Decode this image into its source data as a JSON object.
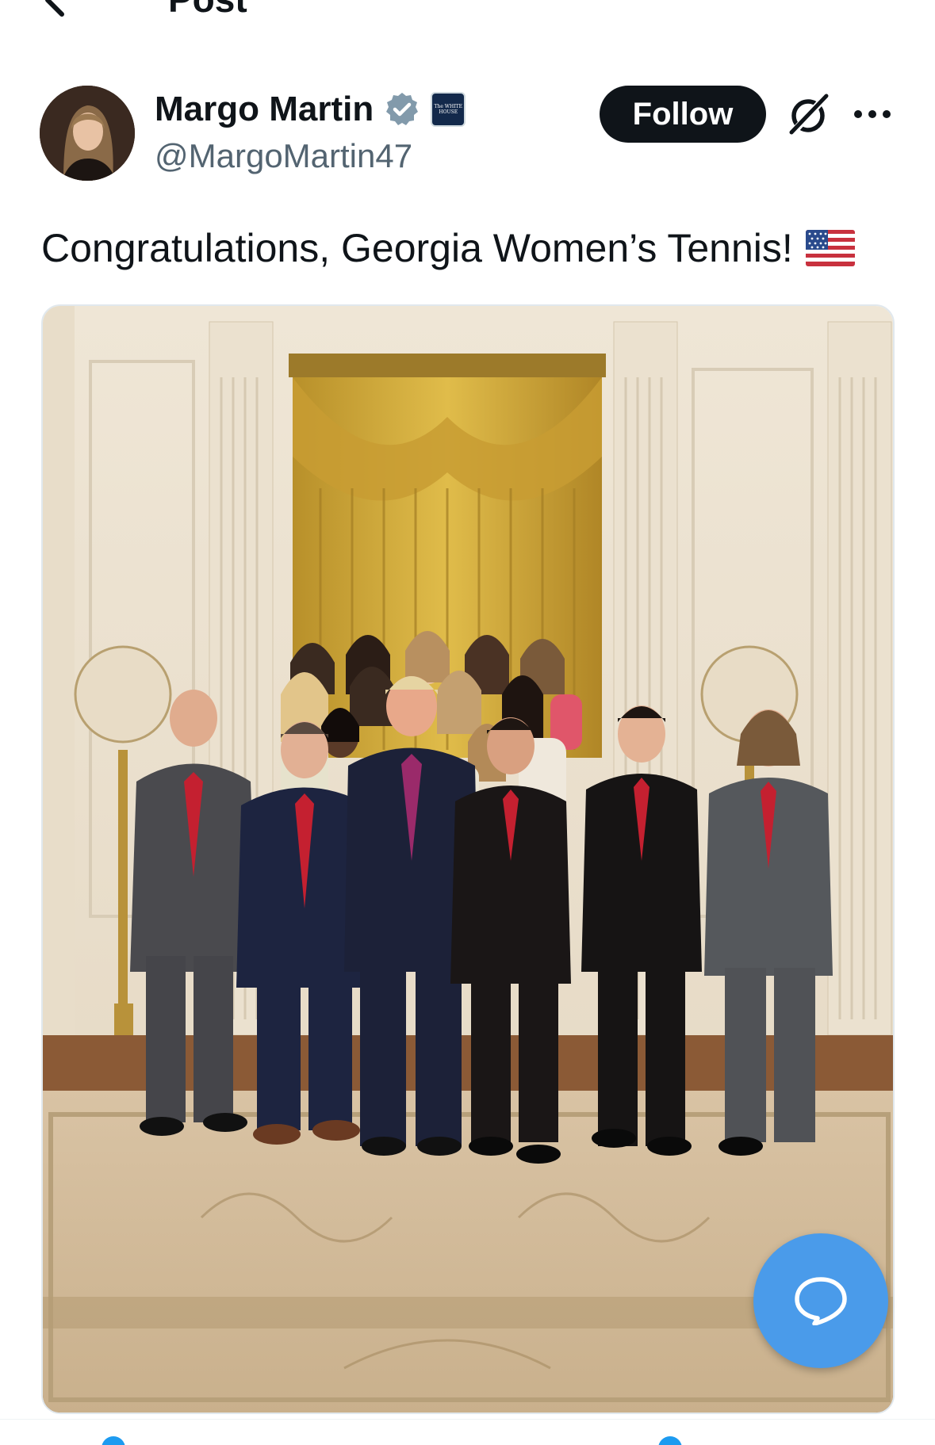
{
  "header": {
    "title": "Post"
  },
  "author": {
    "display_name": "Margo Martin",
    "handle": "@MargoMartin47",
    "affiliate_badge_text": "The WHITE HOUSE"
  },
  "actions": {
    "follow_label": "Follow"
  },
  "post": {
    "text": "Congratulations, Georgia Women’s Tennis!"
  },
  "icons": {
    "back": "back-arrow-icon",
    "verified": "verified-badge-icon",
    "affiliate": "white-house-affiliate-icon",
    "grok": "grok-icon",
    "more": "more-options-icon",
    "flag": "us-flag-icon",
    "reply": "chat-bubble-icon"
  },
  "colors": {
    "accent": "#1d9bf0",
    "follow_bg": "#0f1419",
    "handle": "#536471",
    "fab": "#4a9bea"
  }
}
